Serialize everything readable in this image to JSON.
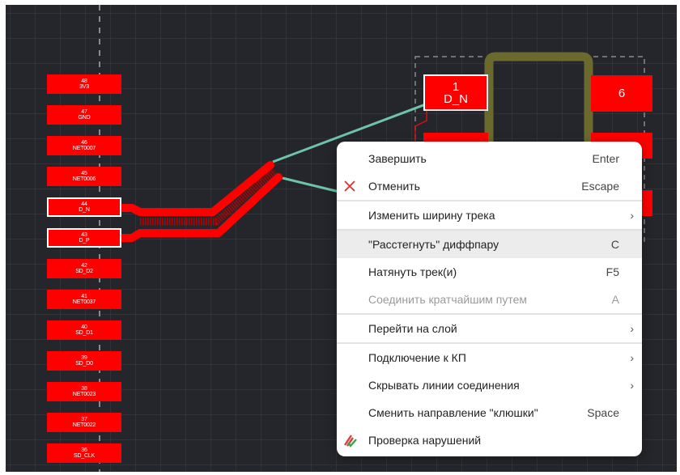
{
  "pins": [
    {
      "number": "48",
      "name": "3V3",
      "selected": false
    },
    {
      "number": "47",
      "name": "GND",
      "selected": false
    },
    {
      "number": "46",
      "name": "NET0007",
      "selected": false
    },
    {
      "number": "45",
      "name": "NET0006",
      "selected": false
    },
    {
      "number": "44",
      "name": "D_N",
      "selected": true
    },
    {
      "number": "43",
      "name": "D_P",
      "selected": true
    },
    {
      "number": "42",
      "name": "SD_D2",
      "selected": false
    },
    {
      "number": "41",
      "name": "NET0037",
      "selected": false
    },
    {
      "number": "40",
      "name": "SD_D1",
      "selected": false
    },
    {
      "number": "39",
      "name": "SD_D0",
      "selected": false
    },
    {
      "number": "38",
      "name": "NET0023",
      "selected": false
    },
    {
      "number": "37",
      "name": "NET0022",
      "selected": false
    },
    {
      "number": "36",
      "name": "SD_CLK",
      "selected": false
    }
  ],
  "component": {
    "pad1_number": "1",
    "pad1_name": "D_N",
    "pad6_number": "6"
  },
  "colors": {
    "background": "#24262b",
    "pad": "#ff0000",
    "outline": "#6b6a2e",
    "ratsnest": "#6fc3a8"
  },
  "menu": {
    "items": [
      {
        "label": "Завершить",
        "shortcut": "Enter",
        "icon": null,
        "submenu": false,
        "disabled": false,
        "highlight": false,
        "sep_after": false
      },
      {
        "label": "Отменить",
        "shortcut": "Escape",
        "icon": "close-x-icon",
        "submenu": false,
        "disabled": false,
        "highlight": false,
        "sep_after": true
      },
      {
        "label": "Изменить ширину трека",
        "shortcut": "",
        "icon": null,
        "submenu": true,
        "disabled": false,
        "highlight": false,
        "sep_after": true
      },
      {
        "label": "\"Расстегнуть\" диффпару",
        "shortcut": "C",
        "icon": null,
        "submenu": false,
        "disabled": false,
        "highlight": true,
        "sep_after": false
      },
      {
        "label": "Натянуть трек(и)",
        "shortcut": "F5",
        "icon": null,
        "submenu": false,
        "disabled": false,
        "highlight": false,
        "sep_after": false
      },
      {
        "label": "Соединить кратчайшим путем",
        "shortcut": "A",
        "icon": null,
        "submenu": false,
        "disabled": true,
        "highlight": false,
        "sep_after": true
      },
      {
        "label": "Перейти на слой",
        "shortcut": "",
        "icon": null,
        "submenu": true,
        "disabled": false,
        "highlight": false,
        "sep_after": true
      },
      {
        "label": "Подключение к КП",
        "shortcut": "",
        "icon": null,
        "submenu": true,
        "disabled": false,
        "highlight": false,
        "sep_after": false
      },
      {
        "label": "Скрывать линии соединения",
        "shortcut": "",
        "icon": null,
        "submenu": true,
        "disabled": false,
        "highlight": false,
        "sep_after": false
      },
      {
        "label": "Сменить направление \"клюшки\"",
        "shortcut": "Space",
        "icon": null,
        "submenu": false,
        "disabled": false,
        "highlight": false,
        "sep_after": false
      },
      {
        "label": "Проверка нарушений",
        "shortcut": "",
        "icon": "drc-check-icon",
        "submenu": false,
        "disabled": false,
        "highlight": false,
        "sep_after": false
      }
    ]
  }
}
